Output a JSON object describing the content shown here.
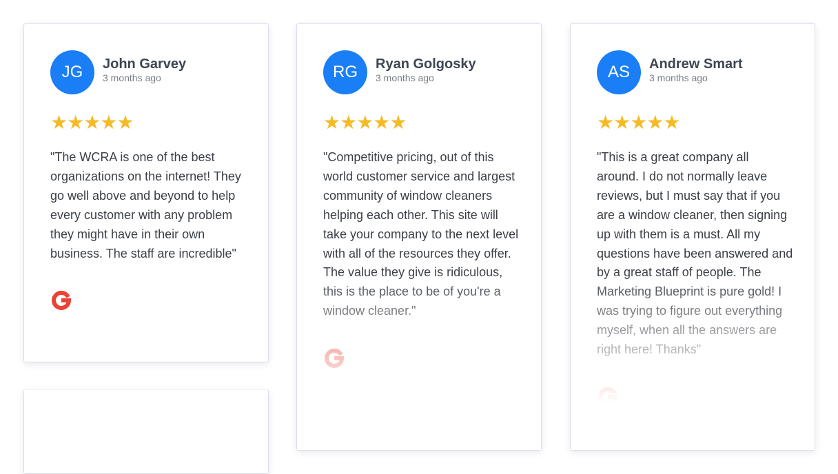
{
  "reviews": [
    {
      "initials": "JG",
      "name": "John Garvey",
      "time": "3 months ago",
      "stars": "★★★★★",
      "text": "\"The WCRA is one of the best organizations on the internet! They go well above and beyond to help every customer with any problem they might have in their own business. The staff are incredible\"",
      "source_icon": "google-icon"
    },
    {
      "initials": "RG",
      "name": "Ryan Golgosky",
      "time": "3 months ago",
      "stars": "★★★★★",
      "text": "\"Competitive pricing, out of this world customer service and largest community of window cleaners helping each other. This site will take your company to the next level with all of the resources they offer. The value they give is ridiculous, this is the place to be of you're a window cleaner.\"",
      "source_icon": "google-icon"
    },
    {
      "initials": "AS",
      "name": "Andrew Smart",
      "time": "3 months ago",
      "stars": "★★★★★",
      "text": "\"This is a great company all around. I do not normally leave reviews, but I must say that if you are a window cleaner, then signing up with them is a must. All my questions have been answered and by a great staff of people. The Marketing Blueprint is pure gold! I was trying to figure out everything myself, when all the answers are right here! Thanks\"",
      "source_icon": "google-icon"
    }
  ],
  "colors": {
    "avatar": "#1a7ef7",
    "stars": "#f5bb27",
    "google": "#ea4335"
  }
}
